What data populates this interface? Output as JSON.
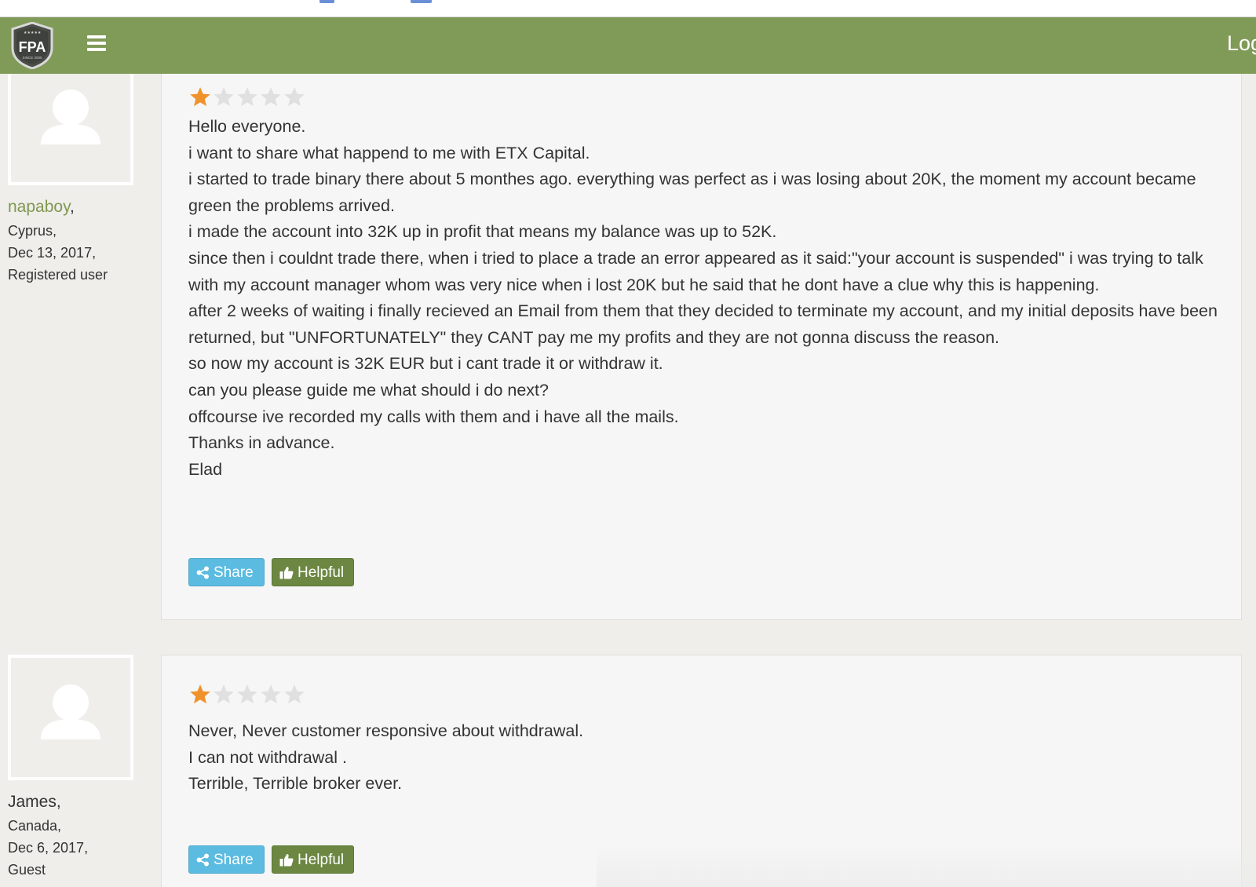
{
  "topbar": {
    "logo_text": "FPA",
    "logo_subtext": "SINCE 2005",
    "login_label": "Log"
  },
  "colors": {
    "header": "#809a58",
    "username_link": "#7e9851",
    "star_filled": "#f0922b",
    "star_empty": "#e0e0e0",
    "share_button": "#5bbbe0",
    "helpful_button": "#6b8741"
  },
  "reviews": [
    {
      "username": "napaboy",
      "name_suffix": ",",
      "country": "Cyprus,",
      "date": "Dec 13, 2017,",
      "user_type": "Registered user",
      "rating": 1,
      "rating_max": 5,
      "paragraphs": [
        "Hello everyone.",
        "i want to share what happend to me with ETX Capital.",
        "i started to trade binary there about 5 monthes ago. everything was perfect as i was losing about 20K, the moment my account became green the problems arrived.",
        "i made the account into 32K up in profit that means my balance was up to 52K.",
        "since then i couldnt trade there, when i tried to place a trade an error appeared as it said:\"your account is suspended\" i was trying to talk with my account manager whom was very nice when i lost 20K but he said that he dont have a clue why this is happening.",
        "after 2 weeks of waiting i finally recieved an Email from them that they decided to terminate my account, and my initial deposits have been returned, but \"UNFORTUNATELY\" they CANT pay me my profits and they are not gonna discuss the reason.",
        "so now my account is 32K EUR but i cant trade it or withdraw it.",
        "can you please guide me what should i do next?",
        "offcourse ive recorded my calls with them and i have all the mails.",
        "Thanks in advance.",
        "Elad"
      ],
      "share_label": "Share",
      "helpful_label": "Helpful"
    },
    {
      "username": "James,",
      "country": "Canada,",
      "date": "Dec 6, 2017,",
      "user_type": "Guest",
      "rating": 1,
      "rating_max": 5,
      "paragraphs": [
        "Never, Never customer responsive about withdrawal.",
        "I can not withdrawal .",
        "Terrible, Terrible broker ever."
      ],
      "share_label": "Share",
      "helpful_label": "Helpful"
    }
  ]
}
